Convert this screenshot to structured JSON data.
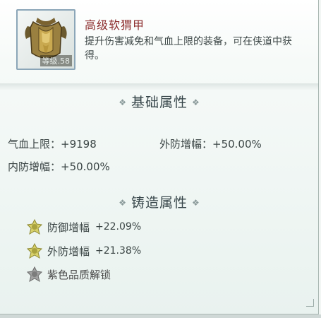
{
  "item": {
    "name": "高级软猬甲",
    "level_tag": "等级.58",
    "description": "提升伤害减免和气血上限的装备，可在侠道中获得。",
    "icon": "armor-vest-icon"
  },
  "basic": {
    "title": "基础属性",
    "stats": [
      "气血上限：+9198",
      "外防增幅：+50.00%",
      "内防增幅：+50.00%"
    ]
  },
  "forge": {
    "title": "铸造属性",
    "rows": [
      {
        "name": "防御增幅",
        "value": "+22.09%",
        "icon": "gold-gem-icon"
      },
      {
        "name": "外防增幅",
        "value": "+21.38%",
        "icon": "gold-gem-icon"
      },
      {
        "name": "紫色品质解锁",
        "value": "",
        "icon": "gray-gem-icon"
      }
    ]
  },
  "colors": {
    "item_name": "#8c2d2d",
    "gem_gold": "#c9c25a",
    "gem_gray": "#8d8d8d"
  }
}
